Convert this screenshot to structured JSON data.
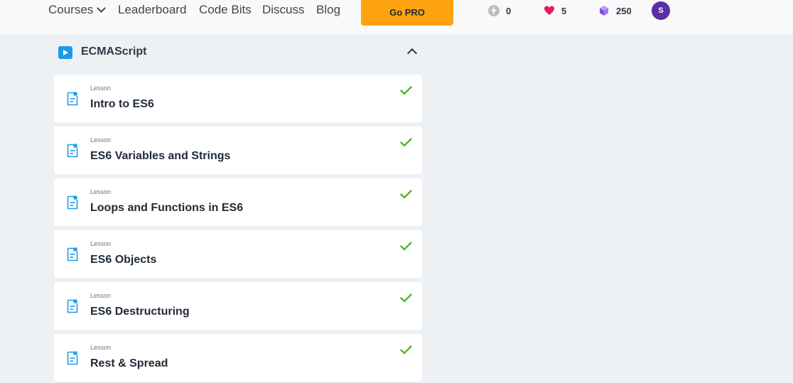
{
  "nav": {
    "courses": "Courses",
    "leaderboard": "Leaderboard",
    "code_bits": "Code Bits",
    "discuss": "Discuss",
    "blog": "Blog",
    "go_pro": "Go PRO"
  },
  "stats": {
    "streak": "0",
    "hearts": "5",
    "gems": "250"
  },
  "avatar_initial": "S",
  "module": {
    "title": "ECMAScript",
    "icon": "play-icon"
  },
  "lessons": [
    {
      "type": "Lesson",
      "title": "Intro to ES6",
      "completed": true
    },
    {
      "type": "Lesson",
      "title": "ES6 Variables and Strings",
      "completed": true
    },
    {
      "type": "Lesson",
      "title": "Loops and Functions in ES6",
      "completed": true
    },
    {
      "type": "Lesson",
      "title": "ES6 Objects",
      "completed": true
    },
    {
      "type": "Lesson",
      "title": "ES6 Destructuring",
      "completed": true
    },
    {
      "type": "Lesson",
      "title": "Rest & Spread",
      "completed": true
    }
  ],
  "colors": {
    "accent": "#ffa310",
    "check": "#52b52c",
    "doc_icon": "#1e9be8",
    "avatar": "#5a2ea6",
    "background": "#eef1f4"
  }
}
